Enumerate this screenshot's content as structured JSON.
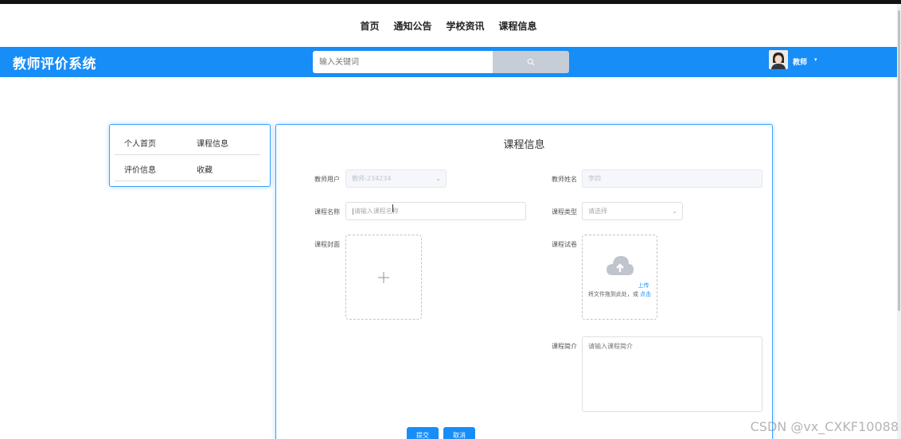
{
  "nav": {
    "items": [
      "首页",
      "通知公告",
      "学校资讯",
      "课程信息"
    ]
  },
  "header": {
    "brand": "教师评价系统",
    "search_placeholder": "输入关键词",
    "user_name": "教师",
    "caret": "▾"
  },
  "sidebar": {
    "items": [
      {
        "label": "个人首页"
      },
      {
        "label": "课程信息"
      },
      {
        "label": "评价信息"
      },
      {
        "label": "收藏"
      }
    ]
  },
  "form": {
    "title": "课程信息",
    "teacher_user": {
      "label": "教师用户",
      "value": "教师-234234"
    },
    "teacher_name": {
      "label": "教师姓名",
      "value": "李四"
    },
    "course_name": {
      "label": "课程名称",
      "placeholder": "请输入课程名称"
    },
    "course_type": {
      "label": "课程类型",
      "placeholder": "请选择"
    },
    "course_cover": {
      "label": "课程封面",
      "icon": "plus-icon"
    },
    "course_paper": {
      "label": "课程试卷",
      "hint": "将文件拖到此处，或",
      "link": "点击上传"
    },
    "course_intro": {
      "label": "课程简介",
      "placeholder": "请输入课程简介"
    },
    "submit": "提交",
    "cancel": "取消"
  },
  "watermark": "CSDN @vx_CXKF10088",
  "colors": {
    "primary": "#178df7",
    "header": "#178df7"
  }
}
